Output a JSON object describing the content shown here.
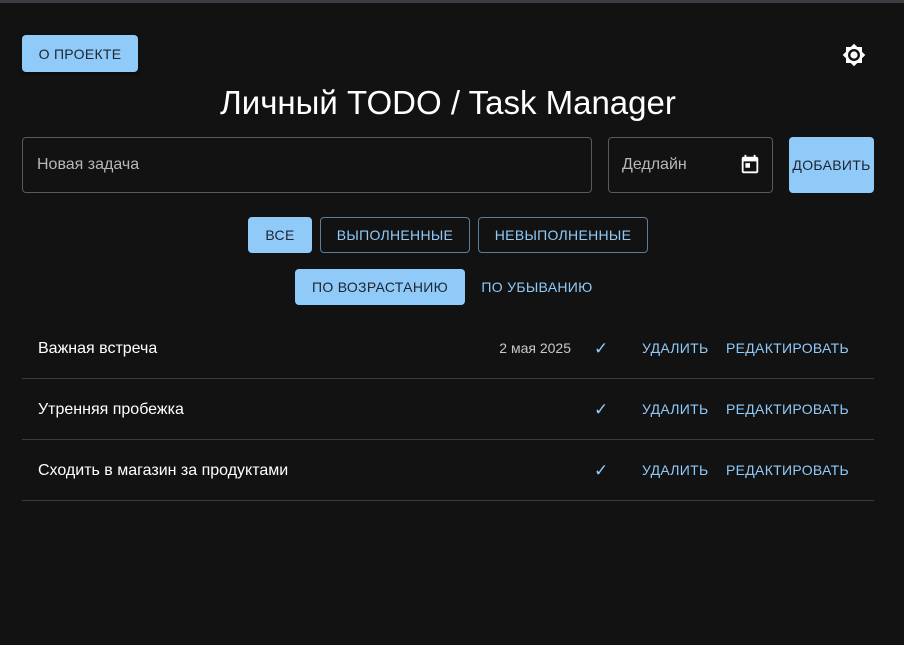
{
  "header": {
    "about_label": "О ПРОЕКТЕ",
    "title": "Личный TODO / Task Manager",
    "theme_icon": "brightness-icon"
  },
  "form": {
    "task_placeholder": "Новая задача",
    "deadline_placeholder": "Дедлайн",
    "calendar_icon": "calendar-icon",
    "add_label": "ДОБАВИТЬ"
  },
  "filters": [
    {
      "label": "ВСЕ",
      "active": true
    },
    {
      "label": "ВЫПОЛНЕННЫЕ",
      "active": false
    },
    {
      "label": "НЕВЫПОЛНЕННЫЕ",
      "active": false
    }
  ],
  "sort": [
    {
      "label": "ПО ВОЗРАСТАНИЮ",
      "active": true
    },
    {
      "label": "ПО УБЫВАНИЮ",
      "active": false
    }
  ],
  "tasks": [
    {
      "title": "Важная встреча",
      "date": "2 мая 2025",
      "check": "✓",
      "delete_label": "УДАЛИТЬ",
      "edit_label": "РЕДАКТИРОВАТЬ"
    },
    {
      "title": "Утренняя пробежка",
      "date": "",
      "check": "✓",
      "delete_label": "УДАЛИТЬ",
      "edit_label": "РЕДАКТИРОВАТЬ"
    },
    {
      "title": "Сходить в магазин за продуктами",
      "date": "",
      "check": "✓",
      "delete_label": "УДАЛИТЬ",
      "edit_label": "РЕДАКТИРОВАТЬ"
    }
  ],
  "colors": {
    "background": "#121212",
    "accent": "#90caf9",
    "border": "#5a5a5a"
  }
}
